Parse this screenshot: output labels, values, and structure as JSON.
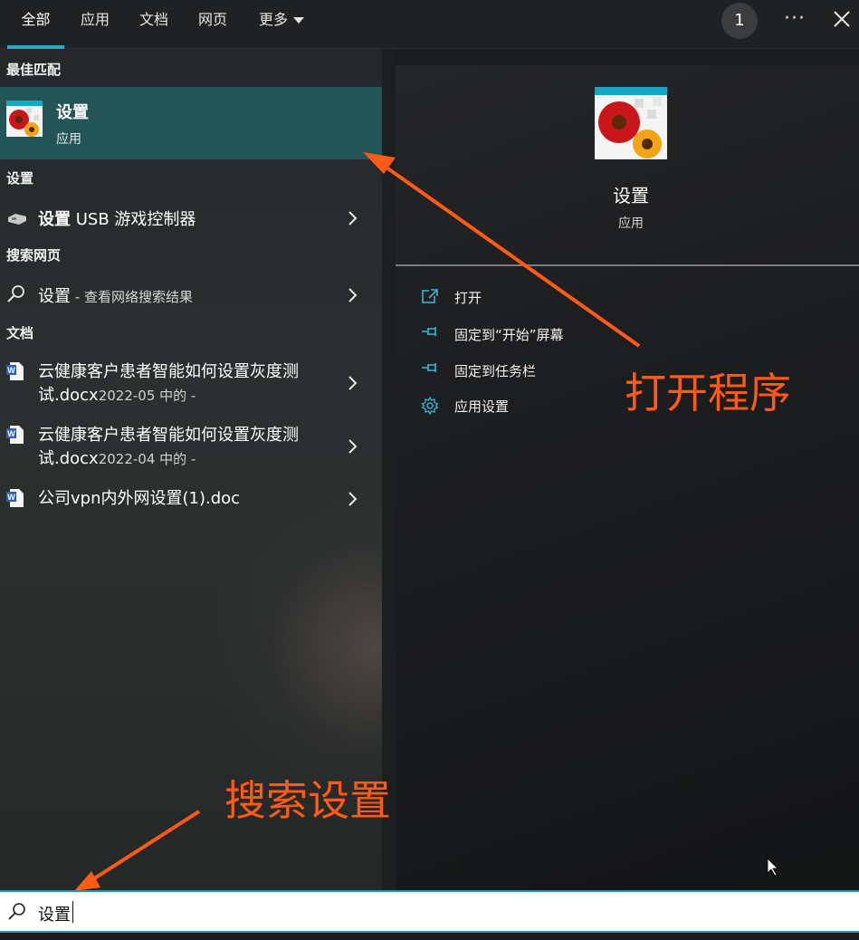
{
  "tabs": [
    {
      "label": "全部",
      "active": true
    },
    {
      "label": "应用"
    },
    {
      "label": "文档"
    },
    {
      "label": "网页"
    },
    {
      "label": "更多"
    }
  ],
  "header": {
    "badge": "1",
    "more": "···"
  },
  "best_match": {
    "heading": "最佳匹配",
    "title": "设置",
    "subtitle": "应用"
  },
  "settings_section": {
    "heading": "设置",
    "item_bold": "设置",
    "item_rest": " USB 游戏控制器"
  },
  "web_section": {
    "heading": "搜索网页",
    "query": "设置",
    "suffix": " - 查看网络搜索结果"
  },
  "docs_section": {
    "heading": "文档",
    "items": [
      {
        "line1": "云健康客户患者智能如何设置灰度测",
        "line2": "试.docx",
        "meta": "2022-05 中的 -"
      },
      {
        "line1": "云健康客户患者智能如何设置灰度测",
        "line2": "试.docx",
        "meta": "2022-04 中的 -"
      },
      {
        "line1": "公司vpn内外网设置(1).doc"
      }
    ]
  },
  "preview": {
    "name": "设置",
    "type": "应用",
    "actions": [
      {
        "label": "打开",
        "icon": "open-icon"
      },
      {
        "label": "固定到“开始”屏幕",
        "icon": "pin-icon"
      },
      {
        "label": "固定到任务栏",
        "icon": "pin-icon"
      },
      {
        "label": "应用设置",
        "icon": "gear-icon"
      }
    ]
  },
  "annotations": {
    "open_program": "打开程序",
    "search_settings": "搜索设置"
  },
  "search": {
    "value": "设置"
  },
  "colors": {
    "accent": "#2ea8c6",
    "highlight": "#235456",
    "annotation": "#ff5a16"
  }
}
